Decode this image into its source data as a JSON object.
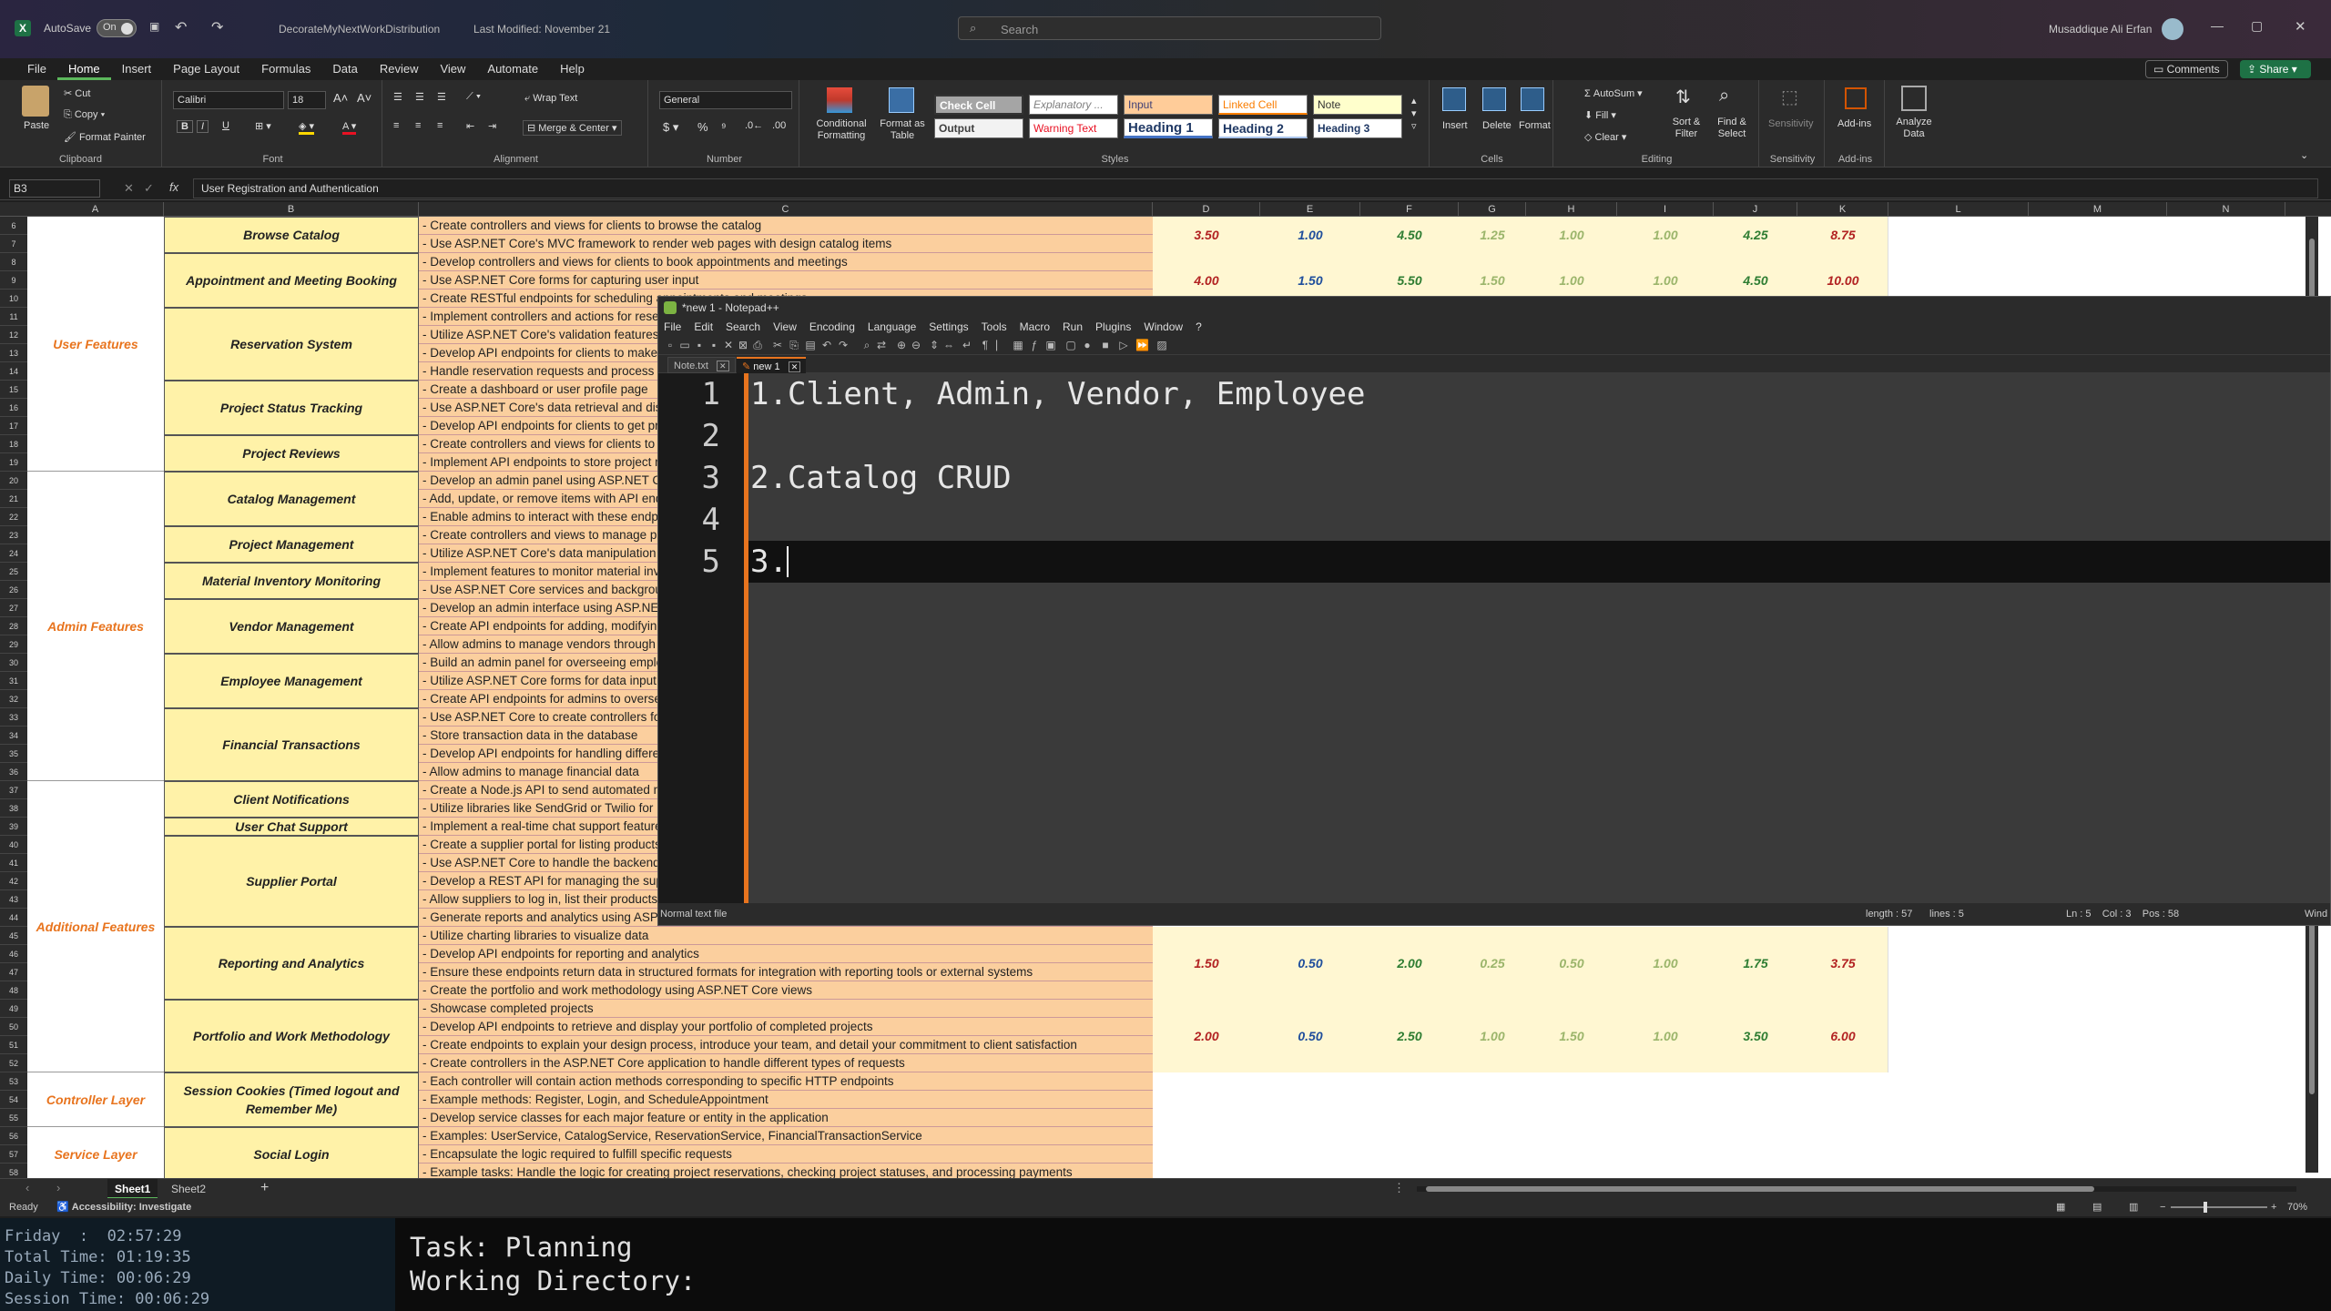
{
  "window": {
    "autosave_label": "AutoSave",
    "autosave_state": "On",
    "filename": "DecorateMyNextWorkDistribution",
    "last_modified": "Last Modified: November 21",
    "search_placeholder": "Search",
    "user_name": "Musaddique Ali Erfan"
  },
  "menu": {
    "tabs": [
      "File",
      "Home",
      "Insert",
      "Page Layout",
      "Formulas",
      "Data",
      "Review",
      "View",
      "Automate",
      "Help"
    ],
    "active": "Home",
    "comments": "Comments",
    "share": "Share"
  },
  "ribbon": {
    "clipboard": {
      "paste": "Paste",
      "cut": "Cut",
      "copy": "Copy",
      "format_painter": "Format Painter",
      "label": "Clipboard"
    },
    "font": {
      "name": "Calibri",
      "size": "18",
      "label": "Font"
    },
    "alignment": {
      "wrap": "Wrap Text",
      "merge": "Merge & Center",
      "label": "Alignment"
    },
    "number": {
      "format": "General",
      "label": "Number"
    },
    "styles": {
      "conditional": "Conditional Formatting",
      "format_table": "Format as Table",
      "cells": [
        "Check Cell",
        "Explanatory ...",
        "Input",
        "Linked Cell",
        "Note",
        "Output",
        "Warning Text",
        "Heading 1",
        "Heading 2",
        "Heading 3"
      ],
      "label": "Styles"
    },
    "cells": {
      "insert": "Insert",
      "delete": "Delete",
      "format": "Format",
      "label": "Cells"
    },
    "editing": {
      "autosum": "AutoSum",
      "fill": "Fill",
      "clear": "Clear",
      "sort": "Sort & Filter",
      "find": "Find & Select",
      "label": "Editing"
    },
    "sensitivity": {
      "btn": "Sensitivity",
      "label": "Sensitivity"
    },
    "addins": {
      "btn": "Add-ins",
      "label": "Add-ins"
    },
    "analyze": {
      "btn": "Analyze Data"
    }
  },
  "formula_bar": {
    "name_box": "B3",
    "fx": "fx",
    "content": "User Registration and Authentication"
  },
  "columns": [
    "A",
    "B",
    "C",
    "D",
    "E",
    "F",
    "G",
    "H",
    "I",
    "J",
    "K",
    "L",
    "M",
    "N"
  ],
  "rows_start": 6,
  "categories": [
    {
      "label": "User Features"
    },
    {
      "label": "Admin Features"
    },
    {
      "label": "Additional Features"
    },
    {
      "label": "Controller Layer"
    },
    {
      "label": "Service Layer"
    }
  ],
  "features": [
    {
      "label": "Browse Catalog"
    },
    {
      "label": "Appointment and Meeting Booking"
    },
    {
      "label": "Reservation System"
    },
    {
      "label": "Project Status Tracking"
    },
    {
      "label": "Project Reviews"
    },
    {
      "label": "Catalog Management"
    },
    {
      "label": "Project Management"
    },
    {
      "label": "Material Inventory Monitoring"
    },
    {
      "label": "Vendor Management"
    },
    {
      "label": "Employee Management"
    },
    {
      "label": "Financial Transactions"
    },
    {
      "label": "Client Notifications"
    },
    {
      "label": "User Chat Support"
    },
    {
      "label": "Supplier Portal"
    },
    {
      "label": "Reporting and Analytics"
    },
    {
      "label": "Portfolio and Work Methodology"
    },
    {
      "label": "Session Cookies (Timed logout and Remember Me)"
    },
    {
      "label": "Social Login"
    }
  ],
  "descriptions": [
    "- Create controllers and views for clients to browse the catalog",
    "- Use ASP.NET Core's MVC framework to render web pages with design catalog items",
    "- Develop controllers and views for clients to book appointments and meetings",
    "- Use ASP.NET Core forms for capturing user input",
    "- Create RESTful endpoints for scheduling appointments and meetings",
    "- Implement controllers and actions for reservations",
    "- Utilize ASP.NET Core's validation features",
    "- Develop API endpoints for clients to make reservations",
    "- Handle reservation requests and process them",
    "- Create a dashboard or user profile page",
    "- Use ASP.NET Core's data retrieval and display",
    "- Develop API endpoints for clients to get project status",
    "- Create controllers and views for clients to leave reviews",
    "- Implement API endpoints to store project reviews",
    "- Develop an admin panel using ASP.NET Core",
    "- Add, update, or remove items with API endpoints",
    "- Enable admins to interact with these endpoints",
    "- Create controllers and views to manage projects",
    "- Utilize ASP.NET Core's data manipulation features",
    "- Implement features to monitor material inventory",
    "- Use ASP.NET Core services and background tasks",
    "- Develop an admin interface using ASP.NET Core",
    "- Create API endpoints for adding, modifying vendors",
    "- Allow admins to manage vendors through the interface",
    "- Build an admin panel for overseeing employees",
    "- Utilize ASP.NET Core forms for data input",
    "- Create API endpoints for admins to oversee employees",
    "- Use ASP.NET Core to create controllers for transactions",
    "- Store transaction data in the database",
    "- Develop API endpoints for handling different transactions",
    "- Allow admins to manage financial data",
    "- Create a Node.js API to send automated notifications",
    "- Utilize libraries like SendGrid or Twilio for notifications",
    "- Implement a real-time chat support feature",
    "- Create a supplier portal for listing products",
    "- Use ASP.NET Core to handle the backend",
    "- Develop a REST API for managing the supplier data",
    "- Allow suppliers to log in, list their products",
    "- Generate reports and analytics using ASP.NET Core",
    "- Utilize charting libraries to visualize data",
    "- Develop API endpoints for reporting and analytics",
    "- Ensure these endpoints return data in structured formats for integration with reporting tools or external systems",
    "- Create the portfolio and work methodology using ASP.NET Core views",
    "- Showcase completed projects",
    "- Develop API endpoints to retrieve and display your portfolio of completed projects",
    "- Create endpoints to explain your design process, introduce your team, and detail your commitment to client satisfaction",
    "- Create controllers in the ASP.NET Core application to handle different types of requests",
    "- Each controller will contain action methods corresponding to specific HTTP endpoints",
    "- Example methods: Register, Login, and ScheduleAppointment",
    "- Develop service classes for each major feature or entity in the application",
    "- Examples: UserService, CatalogService, ReservationService, FinancialTransactionService",
    "- Encapsulate the logic required to fulfill specific requests",
    "- Example tasks: Handle the logic for creating project reservations, checking project statuses, and processing payments"
  ],
  "numbers": [
    {
      "feature": "Browse Catalog",
      "values": [
        "3.50",
        "1.00",
        "4.50",
        "1.25",
        "1.00",
        "1.00",
        "4.25",
        "8.75"
      ]
    },
    {
      "feature": "Appointment and Meeting Booking",
      "values": [
        "4.00",
        "1.50",
        "5.50",
        "1.50",
        "1.00",
        "1.00",
        "4.50",
        "10.00"
      ]
    },
    {
      "feature": "Reporting and Analytics",
      "values": [
        "1.50",
        "0.50",
        "2.00",
        "0.25",
        "0.50",
        "1.00",
        "1.75",
        "3.75"
      ]
    },
    {
      "feature": "Portfolio and Work Methodology",
      "values": [
        "2.00",
        "0.50",
        "2.50",
        "1.00",
        "1.50",
        "1.00",
        "3.50",
        "6.00"
      ]
    }
  ],
  "notepad": {
    "title": "*new 1 - Notepad++",
    "menu": [
      "File",
      "Edit",
      "Search",
      "View",
      "Encoding",
      "Language",
      "Settings",
      "Tools",
      "Macro",
      "Run",
      "Plugins",
      "Window",
      "?"
    ],
    "tabs": [
      "Note.txt",
      "new 1"
    ],
    "lines": [
      "1.Client, Admin, Vendor, Employee",
      "",
      "2.Catalog CRUD",
      "",
      "3."
    ],
    "line_numbers": [
      "1",
      "2",
      "3",
      "4",
      "5"
    ],
    "status": {
      "type": "Normal text file",
      "length": "length : 57",
      "lines": "lines : 5",
      "pos": "Ln : 5    Col : 3    Pos : 58",
      "eol": "Wind"
    }
  },
  "sheet_tabs": [
    "Sheet1",
    "Sheet2"
  ],
  "status_bar": {
    "ready": "Ready",
    "accessibility": "Accessibility: Investigate",
    "zoom": "70%"
  },
  "terminal": {
    "left": [
      "Friday  :  02:57:29",
      "Total Time: 01:19:35",
      "Daily Time: 00:06:29",
      "Session Time: 00:06:29"
    ],
    "right": [
      "Task: Planning",
      "Working Directory:"
    ]
  },
  "colors": {
    "category": "#e8741e",
    "feature_bg": "#fff2a8",
    "desc_bg": "#fbcf9e",
    "num_red": "#b22222",
    "num_green": "#2e7d32",
    "num_light": "#9bb56b",
    "num_blue": "#1f4e9c"
  }
}
